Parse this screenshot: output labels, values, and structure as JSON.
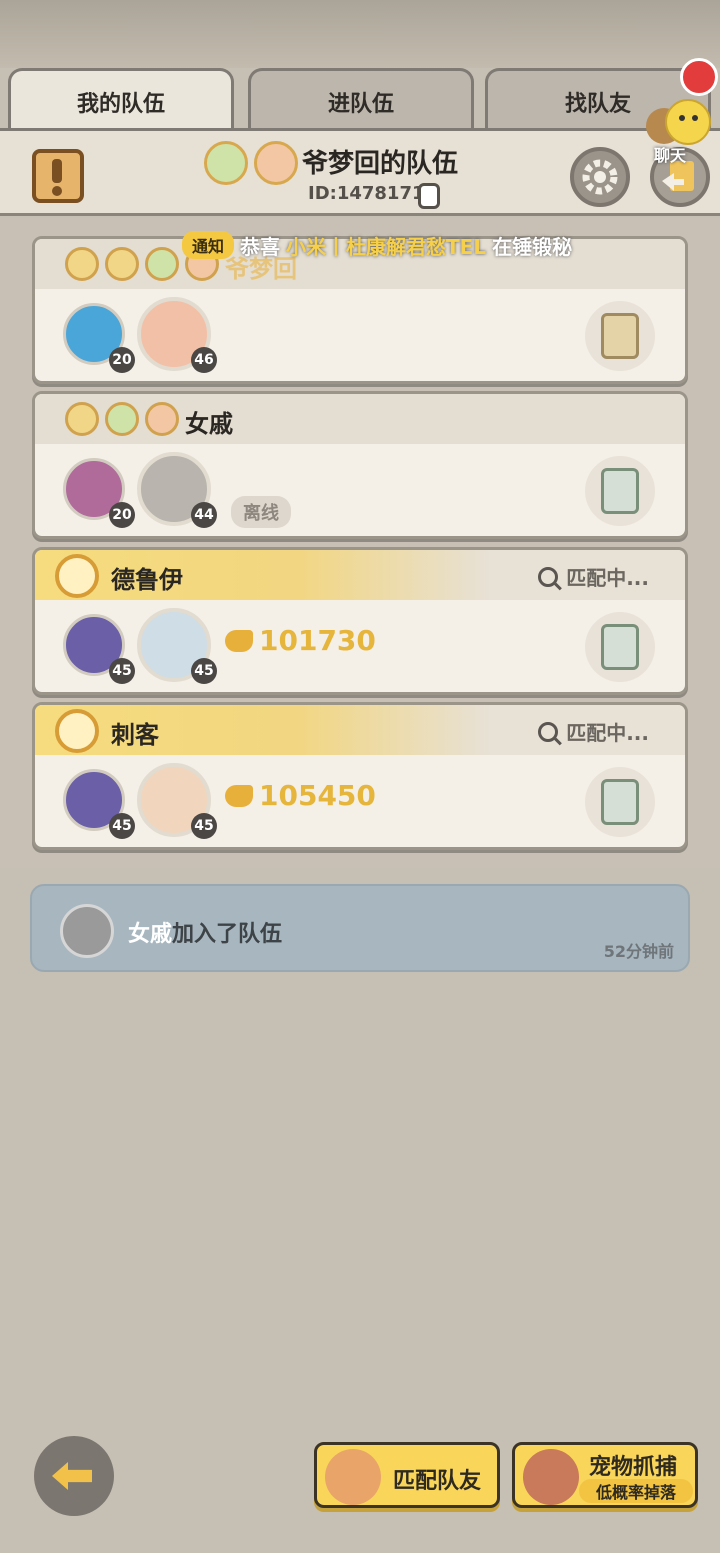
{
  "tabs": [
    {
      "label": "我的队伍",
      "active": true
    },
    {
      "label": "进队伍",
      "active": false
    },
    {
      "label": "找队友",
      "active": false
    }
  ],
  "header": {
    "team_name": "爷梦回的队伍",
    "team_id": "ID:1478171"
  },
  "notification": {
    "tag": "通知",
    "prefix": "恭喜",
    "highlight": "小米丨杜康解君愁TEL",
    "suffix": "在锤锻秘"
  },
  "chat": {
    "label": "聊天"
  },
  "members": [
    {
      "name": "爷梦回",
      "pet_level": "20",
      "hero_level": "46"
    },
    {
      "name": "女戚",
      "pet_level": "20",
      "hero_level": "44",
      "status": "离线"
    }
  ],
  "recruits": [
    {
      "role": "德鲁伊",
      "matching": "匹配中...",
      "pet_level": "45",
      "hero_level": "45",
      "power": "101730"
    },
    {
      "role": "刺客",
      "matching": "匹配中...",
      "pet_level": "45",
      "hero_level": "45",
      "power": "105450"
    }
  ],
  "log": {
    "name": "女戚",
    "text": "加入了队伍",
    "time": "52分钟前"
  },
  "buttons": {
    "match": "匹配队友",
    "pet_capture": "宠物抓捕",
    "pet_capture_sub": "低概率掉落"
  },
  "colors": {
    "accent_yellow": "#f9d55a",
    "power_gold": "#e6b53b",
    "notify_red": "#e23c3c"
  }
}
